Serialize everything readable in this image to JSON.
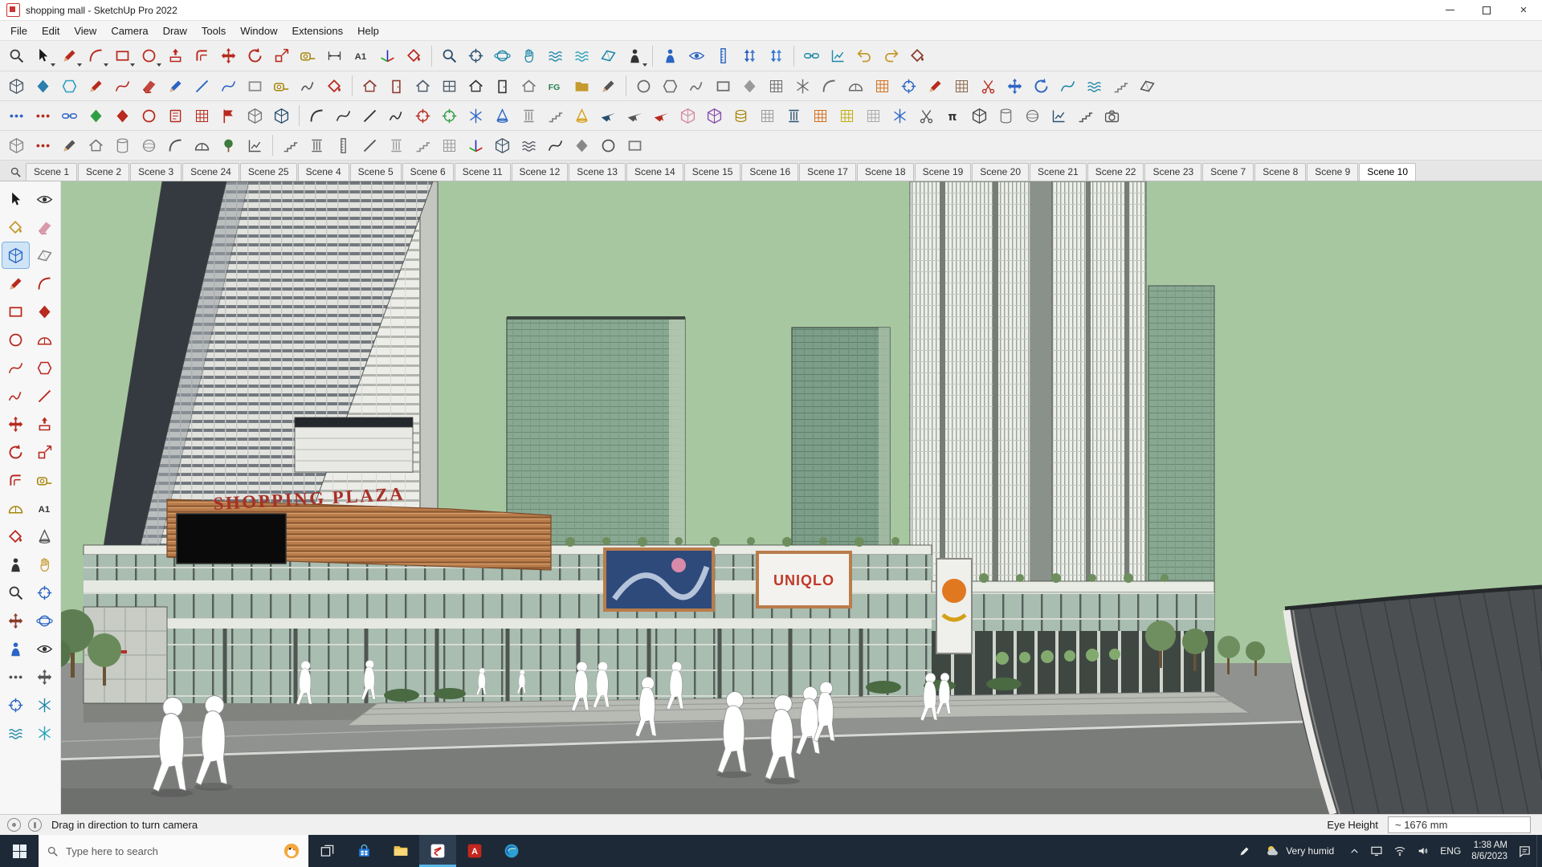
{
  "window": {
    "title": "shopping mall - SketchUp Pro 2022"
  },
  "menu": {
    "items": [
      "File",
      "Edit",
      "View",
      "Camera",
      "Draw",
      "Tools",
      "Window",
      "Extensions",
      "Help"
    ]
  },
  "toolbars": {
    "row1": [
      {
        "n": "zoom-search",
        "g": "magnify",
        "c": "#3a3a3a"
      },
      {
        "n": "select",
        "g": "arrow",
        "c": "#1a1a1a",
        "cr": 1
      },
      {
        "n": "line",
        "g": "pencil",
        "c": "#b8291e",
        "cr": 1
      },
      {
        "n": "arc",
        "g": "arc",
        "c": "#b8291e",
        "cr": 1
      },
      {
        "n": "rectangle",
        "g": "rect",
        "c": "#b8291e",
        "cr": 1
      },
      {
        "n": "circle",
        "g": "circle",
        "c": "#b8291e",
        "cr": 1
      },
      {
        "n": "pushpull",
        "g": "pushpull",
        "c": "#b8291e"
      },
      {
        "n": "offset",
        "g": "offset",
        "c": "#b8291e"
      },
      {
        "n": "move",
        "g": "move",
        "c": "#b8291e"
      },
      {
        "n": "rotate",
        "g": "rotate",
        "c": "#b8291e"
      },
      {
        "n": "scale",
        "g": "scale",
        "c": "#b8291e"
      },
      {
        "n": "tape-measure",
        "g": "tape",
        "c": "#a8860b"
      },
      {
        "n": "dimension",
        "g": "dims",
        "c": "#3a3a3a"
      },
      {
        "n": "text",
        "g": "a1",
        "c": "#3a3a3a"
      },
      {
        "n": "axes",
        "g": "axes",
        "c": "#b8291e"
      },
      {
        "n": "paint-bucket",
        "g": "bucket",
        "c": "#b8291e"
      },
      {
        "sep": 1
      },
      {
        "n": "zoom",
        "g": "magnify",
        "c": "#2a4f6e"
      },
      {
        "n": "zoom-window",
        "g": "target",
        "c": "#2a4f6e"
      },
      {
        "n": "orbit",
        "g": "orbit",
        "c": "#1d87a8"
      },
      {
        "n": "pan",
        "g": "hand",
        "c": "#1d87a8"
      },
      {
        "n": "sandbox-contours",
        "g": "wave",
        "c": "#1d87a8"
      },
      {
        "n": "sandbox-scratch",
        "g": "wave",
        "c": "#23a0b8"
      },
      {
        "n": "section-plane",
        "g": "section",
        "c": "#1d87a8"
      },
      {
        "n": "component",
        "g": "person",
        "c": "#333333",
        "cr": 1
      },
      {
        "sep": 1
      },
      {
        "n": "position-camera",
        "g": "person",
        "c": "#2b64c4"
      },
      {
        "n": "look-around",
        "g": "eye",
        "c": "#2b64c4"
      },
      {
        "n": "walk-height",
        "g": "ruler",
        "c": "#2b64c4"
      },
      {
        "n": "eye-height-up",
        "g": "updown",
        "c": "#2b64c4"
      },
      {
        "n": "eye-height-down",
        "g": "updown",
        "c": "#2f74d4"
      },
      {
        "sep": 1
      },
      {
        "n": "connect",
        "g": "link",
        "c": "#1d87a8"
      },
      {
        "n": "profile-graph",
        "g": "chart",
        "c": "#1d87a8"
      },
      {
        "n": "undo",
        "g": "undo",
        "c": "#c59a2f"
      },
      {
        "n": "redo",
        "g": "undo",
        "c": "#c59a2f",
        "fl": 1
      },
      {
        "n": "material-replace",
        "g": "bucket",
        "c": "#8a3a2a"
      }
    ],
    "row2": [
      {
        "n": "fredo-box",
        "g": "box3d",
        "c": "#4a5a6a"
      },
      {
        "n": "fredo-diamond",
        "g": "diamond",
        "c": "#2a7fae"
      },
      {
        "n": "round-corner",
        "g": "hex",
        "c": "#2aa0c0"
      },
      {
        "n": "pencil-red",
        "g": "pencil",
        "c": "#b8291e"
      },
      {
        "n": "curve-red",
        "g": "curve",
        "c": "#b8291e"
      },
      {
        "n": "eraser-red",
        "g": "eraser",
        "c": "#b8291e"
      },
      {
        "n": "pencil-blue",
        "g": "pencil",
        "c": "#2b64c4"
      },
      {
        "n": "line-blue",
        "g": "line",
        "c": "#2b64c4"
      },
      {
        "n": "curve-blue",
        "g": "curve",
        "c": "#2b64c4"
      },
      {
        "n": "rect-light",
        "g": "rect",
        "c": "#8a8a8a"
      },
      {
        "n": "tape-2",
        "g": "tape",
        "c": "#a8860b"
      },
      {
        "n": "freehand-gray",
        "g": "freehand",
        "c": "#555555"
      },
      {
        "n": "paint-2",
        "g": "bucket",
        "c": "#b8291e"
      },
      {
        "sep": 1
      },
      {
        "n": "house-red",
        "g": "house",
        "c": "#8a3a2a"
      },
      {
        "n": "door-red",
        "g": "door",
        "c": "#8a3a2a"
      },
      {
        "n": "house-slate",
        "g": "house",
        "c": "#4a5a6a"
      },
      {
        "n": "window-slate",
        "g": "window2",
        "c": "#4a5a6a"
      },
      {
        "n": "house-dark",
        "g": "house",
        "c": "#333333"
      },
      {
        "n": "door-dark",
        "g": "door",
        "c": "#333333"
      },
      {
        "n": "roof-gray",
        "g": "house",
        "c": "#777777"
      },
      {
        "n": "fg-tool",
        "g": "fg",
        "c": "#2a7f4f"
      },
      {
        "n": "folder-tool",
        "g": "folder",
        "c": "#c59a2f"
      },
      {
        "n": "pencil-gray",
        "g": "pencil",
        "c": "#555555"
      },
      {
        "sep": 1
      },
      {
        "n": "shape-ellipse",
        "g": "circle",
        "c": "#6a6a6a"
      },
      {
        "n": "shape-hex",
        "g": "hex",
        "c": "#6a6a6a"
      },
      {
        "n": "shape-lasso",
        "g": "freehand",
        "c": "#6a6a6a"
      },
      {
        "n": "shape-rect",
        "g": "rect",
        "c": "#6a6a6a"
      },
      {
        "n": "shape-poly",
        "g": "diamond",
        "c": "#9a9a9a"
      },
      {
        "n": "shape-grid",
        "g": "grid",
        "c": "#6a6a6a"
      },
      {
        "n": "shape-star",
        "g": "snow",
        "c": "#6a6a6a"
      },
      {
        "n": "shape-arc",
        "g": "arc",
        "c": "#6a6a6a"
      },
      {
        "n": "shape-pie",
        "g": "protractor",
        "c": "#6a6a6a"
      },
      {
        "n": "grid-orange",
        "g": "grid",
        "c": "#d4711f"
      },
      {
        "n": "target-blue",
        "g": "target",
        "c": "#2b64c4"
      },
      {
        "n": "pencil-tip",
        "g": "pencil",
        "c": "#b8291e"
      },
      {
        "n": "hatch-brown",
        "g": "grid",
        "c": "#8a6a4a"
      },
      {
        "n": "scissors-red",
        "g": "scissors",
        "c": "#b8291e"
      },
      {
        "n": "move-blue",
        "g": "move",
        "c": "#2b64c4"
      },
      {
        "n": "rotate-blue",
        "g": "rotate",
        "c": "#2b64c4"
      },
      {
        "n": "curve-teal",
        "g": "curve",
        "c": "#1d87a8"
      },
      {
        "n": "wave-teal",
        "g": "wave",
        "c": "#1d87a8"
      },
      {
        "n": "slope-tool",
        "g": "stairs",
        "c": "#777777"
      },
      {
        "n": "section-2",
        "g": "section",
        "c": "#555555"
      }
    ],
    "row3": [
      {
        "n": "points-blue",
        "g": "dots",
        "c": "#2b64c4"
      },
      {
        "n": "points-red",
        "g": "dots",
        "c": "#b8291e"
      },
      {
        "n": "weld",
        "g": "link",
        "c": "#2b64c4"
      },
      {
        "n": "diamond-green",
        "g": "diamond",
        "c": "#2f9e44"
      },
      {
        "n": "diamond-red",
        "g": "diamond",
        "c": "#b8291e"
      },
      {
        "n": "circle-red",
        "g": "circle",
        "c": "#b8291e"
      },
      {
        "n": "book-red",
        "g": "book",
        "c": "#b8291e"
      },
      {
        "n": "panel-red",
        "g": "grid",
        "c": "#b8291e"
      },
      {
        "n": "flag-red",
        "g": "flag",
        "c": "#b8291e"
      },
      {
        "n": "box-gray",
        "g": "box3d",
        "c": "#777777"
      },
      {
        "n": "box-navy",
        "g": "box3d",
        "c": "#29506e"
      },
      {
        "sep": 1
      },
      {
        "n": "edge-arc",
        "g": "arc",
        "c": "#333333"
      },
      {
        "n": "edge-curve",
        "g": "curve",
        "c": "#333333"
      },
      {
        "n": "edge-line",
        "g": "line",
        "c": "#333333"
      },
      {
        "n": "edge-freehand",
        "g": "freehand",
        "c": "#333333"
      },
      {
        "n": "plus-red",
        "g": "target",
        "c": "#b8291e"
      },
      {
        "n": "plus-green",
        "g": "target",
        "c": "#2f9e44"
      },
      {
        "n": "snow-blue",
        "g": "snow",
        "c": "#2b64c4"
      },
      {
        "n": "cone-blue",
        "g": "cone",
        "c": "#2b64c4"
      },
      {
        "n": "column-gray",
        "g": "column",
        "c": "#8a8a8a"
      },
      {
        "n": "stairs-gray",
        "g": "stairs",
        "c": "#777777"
      },
      {
        "n": "cone-yellow",
        "g": "cone",
        "c": "#d4a017"
      },
      {
        "n": "plane-navy",
        "g": "plane",
        "c": "#29506e"
      },
      {
        "n": "plane-gray",
        "g": "plane",
        "c": "#555555"
      },
      {
        "n": "rocket-red",
        "g": "plane",
        "c": "#b8291e"
      },
      {
        "n": "box-pink",
        "g": "box3d",
        "c": "#d48a9e"
      },
      {
        "n": "box-purple",
        "g": "box3d",
        "c": "#8a4aae"
      },
      {
        "n": "coins",
        "g": "coins",
        "c": "#a8860b"
      },
      {
        "n": "hatch-gray",
        "g": "grid",
        "c": "#9a9a9a"
      },
      {
        "n": "ibeam",
        "g": "column",
        "c": "#29506e"
      },
      {
        "n": "grid-orange-2",
        "g": "grid",
        "c": "#d4711f"
      },
      {
        "n": "grid-yellow",
        "g": "grid",
        "c": "#c4b017"
      },
      {
        "n": "grid-light",
        "g": "grid",
        "c": "#aaaaaa"
      },
      {
        "n": "scatter",
        "g": "snow",
        "c": "#2b64c4"
      },
      {
        "n": "scissors-gray",
        "g": "scissors",
        "c": "#555555"
      },
      {
        "n": "pi-tool",
        "g": "pi",
        "c": "#333333"
      },
      {
        "n": "cube-dark",
        "g": "box3d",
        "c": "#444444"
      },
      {
        "n": "cylinder-gray",
        "g": "cyl",
        "c": "#777777"
      },
      {
        "n": "sphere-gray",
        "g": "sphere",
        "c": "#777777"
      },
      {
        "n": "graph-navy",
        "g": "chart",
        "c": "#29506e"
      },
      {
        "n": "steps-gray",
        "g": "stairs",
        "c": "#555555"
      },
      {
        "n": "camera-tool",
        "g": "camera",
        "c": "#555555"
      }
    ],
    "row4": [
      {
        "n": "cube-outline",
        "g": "box3d",
        "c": "#888888"
      },
      {
        "n": "points-red-2",
        "g": "dots",
        "c": "#b8291e"
      },
      {
        "n": "pencil-4",
        "g": "pencil",
        "c": "#555555"
      },
      {
        "n": "roof-2",
        "g": "house",
        "c": "#777777"
      },
      {
        "n": "cylinder-2",
        "g": "cyl",
        "c": "#888888"
      },
      {
        "n": "sphere-2",
        "g": "sphere",
        "c": "#888888"
      },
      {
        "n": "arc-4",
        "g": "arc",
        "c": "#555555"
      },
      {
        "n": "dome",
        "g": "protractor",
        "c": "#555555"
      },
      {
        "n": "tree-tool",
        "g": "tree",
        "c": "#3e7a3e"
      },
      {
        "n": "graph-4",
        "g": "chart",
        "c": "#555555"
      },
      {
        "sep": 1
      },
      {
        "n": "stairs-4",
        "g": "stairs",
        "c": "#666666"
      },
      {
        "n": "fence",
        "g": "column",
        "c": "#666666"
      },
      {
        "n": "ladder",
        "g": "ruler",
        "c": "#666666"
      },
      {
        "n": "line-4",
        "g": "line",
        "c": "#555555"
      },
      {
        "n": "column-4",
        "g": "column",
        "c": "#999999"
      },
      {
        "n": "steps-4",
        "g": "stairs",
        "c": "#888888"
      },
      {
        "n": "grid-4",
        "g": "grid",
        "c": "#999999"
      },
      {
        "n": "axes-2",
        "g": "axes",
        "c": "#333333"
      },
      {
        "n": "cube-navy",
        "g": "box3d",
        "c": "#445a6e"
      },
      {
        "n": "wave-4",
        "g": "wave",
        "c": "#555566"
      },
      {
        "n": "curve-4",
        "g": "curve",
        "c": "#333333"
      },
      {
        "n": "diamond-4",
        "g": "diamond",
        "c": "#888888"
      },
      {
        "n": "circle-4",
        "g": "circle",
        "c": "#555555"
      },
      {
        "n": "rect-4",
        "g": "rect",
        "c": "#777777"
      }
    ],
    "palette": [
      {
        "n": "pal-select",
        "g": "arrow",
        "c": "#1a1a1a"
      },
      {
        "n": "pal-orbit-eye",
        "g": "eye",
        "c": "#333333"
      },
      {
        "n": "pal-paint",
        "g": "bucket",
        "c": "#c59a2f"
      },
      {
        "n": "pal-eraser",
        "g": "eraser",
        "c": "#d48a9e"
      },
      {
        "n": "pal-cube",
        "g": "box3d",
        "c": "#2b64c4",
        "act": 1
      },
      {
        "n": "pal-section",
        "g": "section",
        "c": "#888888"
      },
      {
        "n": "pal-line",
        "g": "pencil",
        "c": "#b8291e"
      },
      {
        "n": "pal-arc",
        "g": "arc",
        "c": "#b8291e"
      },
      {
        "n": "pal-rect",
        "g": "rect",
        "c": "#b8291e"
      },
      {
        "n": "pal-rot-rect",
        "g": "diamond",
        "c": "#b8291e"
      },
      {
        "n": "pal-circle",
        "g": "circle",
        "c": "#b8291e"
      },
      {
        "n": "pal-pie",
        "g": "protractor",
        "c": "#b8291e"
      },
      {
        "n": "pal-curve",
        "g": "curve",
        "c": "#b8291e"
      },
      {
        "n": "pal-polygon",
        "g": "hex",
        "c": "#b8291e"
      },
      {
        "n": "pal-freehand",
        "g": "freehand",
        "c": "#b8291e"
      },
      {
        "n": "pal-line-2",
        "g": "line",
        "c": "#b8291e"
      },
      {
        "n": "pal-move",
        "g": "move",
        "c": "#b8291e"
      },
      {
        "n": "pal-pushpull",
        "g": "pushpull",
        "c": "#b8291e"
      },
      {
        "n": "pal-rotate",
        "g": "rotate",
        "c": "#b8291e"
      },
      {
        "n": "pal-scale",
        "g": "scale",
        "c": "#b8291e"
      },
      {
        "n": "pal-offset",
        "g": "offset",
        "c": "#b8291e"
      },
      {
        "n": "pal-tape",
        "g": "tape",
        "c": "#a8860b"
      },
      {
        "n": "pal-protractor",
        "g": "protractor",
        "c": "#a8860b"
      },
      {
        "n": "pal-text",
        "g": "a1",
        "c": "#333333"
      },
      {
        "n": "pal-paint-2",
        "g": "bucket",
        "c": "#b8291e"
      },
      {
        "n": "pal-cone",
        "g": "cone",
        "c": "#555555"
      },
      {
        "n": "pal-walk",
        "g": "person",
        "c": "#333333"
      },
      {
        "n": "pal-hand",
        "g": "hand",
        "c": "#c59a2f"
      },
      {
        "n": "pal-zoom",
        "g": "magnify",
        "c": "#333333"
      },
      {
        "n": "pal-zoom-window",
        "g": "target",
        "c": "#2b64c4"
      },
      {
        "n": "pal-move-2",
        "g": "move",
        "c": "#8a3a2a"
      },
      {
        "n": "pal-orbit",
        "g": "orbit",
        "c": "#2b64c4"
      },
      {
        "n": "pal-position",
        "g": "person",
        "c": "#2b64c4"
      },
      {
        "n": "pal-look",
        "g": "eye",
        "c": "#333333"
      },
      {
        "n": "pal-footprints",
        "g": "dots",
        "c": "#555555"
      },
      {
        "n": "pal-pan-4way",
        "g": "move",
        "c": "#555555"
      },
      {
        "n": "pal-target",
        "g": "target",
        "c": "#2b64c4"
      },
      {
        "n": "pal-snow",
        "g": "snow",
        "c": "#1d87a8"
      },
      {
        "n": "pal-wave",
        "g": "wave",
        "c": "#1d87a8"
      },
      {
        "n": "pal-smooth",
        "g": "snow",
        "c": "#23a0b8"
      }
    ]
  },
  "scene_tabs": {
    "tabs": [
      "Scene 1",
      "Scene 2",
      "Scene 3",
      "Scene 24",
      "Scene 25",
      "Scene 4",
      "Scene 5",
      "Scene 6",
      "Scene 11",
      "Scene 12",
      "Scene 13",
      "Scene 14",
      "Scene 15",
      "Scene 16",
      "Scene 17",
      "Scene 18",
      "Scene 19",
      "Scene 20",
      "Scene 21",
      "Scene 22",
      "Scene 23",
      "Scene 7",
      "Scene 8",
      "Scene 9",
      "Scene 10"
    ],
    "active": "Scene 10"
  },
  "viewport": {
    "signs": {
      "plaza": "SHOPPING PLAZA",
      "uniqlo": "UNIQLO"
    },
    "colors": {
      "sky": "#a7c7a1",
      "ground": "#909290",
      "road": "#7a7c7a",
      "copper": "#b97c4b",
      "sign_red": "#a83028"
    }
  },
  "statusbar": {
    "hint": "Drag in direction to turn camera",
    "eye_height_label": "Eye Height",
    "eye_height_value": "~ 1676 mm"
  },
  "taskbar": {
    "search_placeholder": "Type here to search",
    "weather": "Very humid",
    "lang": "ENG",
    "time": "1:38 AM",
    "date": "8/6/2023",
    "adobe_label": "A"
  }
}
